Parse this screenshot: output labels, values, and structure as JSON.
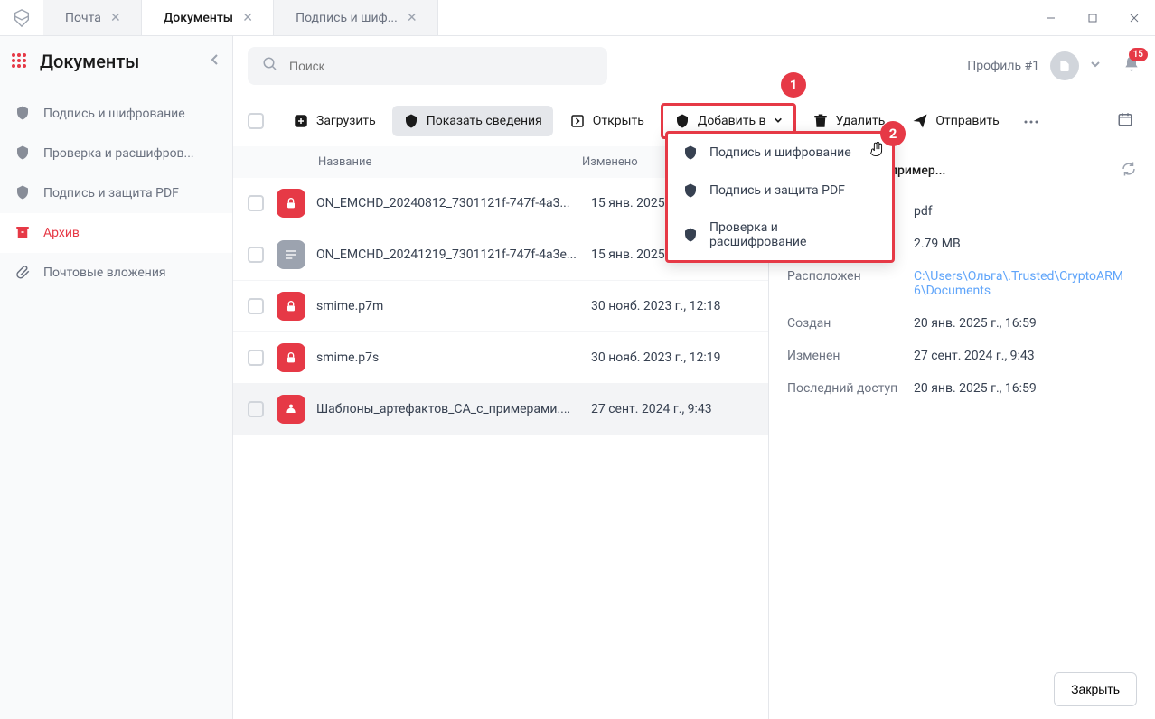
{
  "tabs": [
    {
      "label": "Почта"
    },
    {
      "label": "Документы"
    },
    {
      "label": "Подпись и шиф..."
    }
  ],
  "sidebar": {
    "title": "Документы",
    "items": [
      {
        "label": "Подпись и шифрование"
      },
      {
        "label": "Проверка и расшифров..."
      },
      {
        "label": "Подпись и защита PDF"
      },
      {
        "label": "Архив"
      },
      {
        "label": "Почтовые вложения"
      }
    ]
  },
  "search": {
    "placeholder": "Поиск"
  },
  "profile": {
    "label": "Профиль #1",
    "notif_count": "15"
  },
  "toolbar": {
    "upload": "Загрузить",
    "details": "Показать сведения",
    "open": "Открыть",
    "add_to": "Добавить в",
    "delete": "Удалить",
    "send": "Отправить"
  },
  "dropdown": {
    "items": [
      {
        "label": "Подпись и шифрование"
      },
      {
        "label": "Подпись и защита PDF"
      },
      {
        "label": "Проверка и расшифрование"
      }
    ]
  },
  "annotations": {
    "badge1": "1",
    "badge2": "2"
  },
  "table": {
    "headers": {
      "name": "Название",
      "modified": "Изменено"
    },
    "rows": [
      {
        "name": "ON_EMCHD_20240812_7301121f-747f-4a3...",
        "date": "15 янв. 2025",
        "icon_color": "red",
        "icon": "lock"
      },
      {
        "name": "ON_EMCHD_20241219_7301121f-747f-4a3e...",
        "date": "15 янв. 2025",
        "icon_color": "gray",
        "icon": "doc"
      },
      {
        "name": "smime.p7m",
        "date": "30 нояб. 2023 г., 12:18",
        "icon_color": "red",
        "icon": "lock"
      },
      {
        "name": "smime.p7s",
        "date": "30 нояб. 2023 г., 12:19",
        "icon_color": "red",
        "icon": "lock"
      },
      {
        "name": "Шаблоны_артефактов_СА_с_примерами....",
        "date": "27 сент. 2024 г., 9:43",
        "icon_color": "red",
        "icon": "pdf"
      }
    ]
  },
  "details": {
    "title": "ртефактов_СА_с_пример...",
    "rows": [
      {
        "label": "",
        "value": "pdf"
      },
      {
        "label": "",
        "value": "2.79 MB"
      },
      {
        "label": "Расположен",
        "value": "C:\\Users\\Ольга\\.Trusted\\CryptoARM 6\\Documents",
        "link": true
      },
      {
        "label": "Создан",
        "value": "20 янв. 2025 г., 16:59"
      },
      {
        "label": "Изменен",
        "value": "27 сент. 2024 г., 9:43"
      },
      {
        "label": "Последний доступ",
        "value": "20 янв. 2025 г., 16:59"
      }
    ]
  },
  "footer": {
    "close": "Закрыть"
  }
}
